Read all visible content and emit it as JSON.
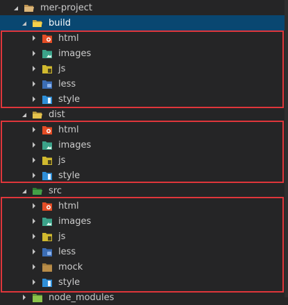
{
  "explorer": {
    "root": {
      "label": "mer-project",
      "icon": "folder-open-icon"
    },
    "build": {
      "label": "build",
      "icon": "folder-open-yellow-icon",
      "children": [
        {
          "label": "html",
          "icon": "html-folder-icon",
          "color": "#e44d26"
        },
        {
          "label": "images",
          "icon": "images-folder-icon",
          "color": "#3ba38a"
        },
        {
          "label": "js",
          "icon": "js-folder-icon",
          "color": "#d1ba2f"
        },
        {
          "label": "less",
          "icon": "less-folder-icon",
          "color": "#3b6db5"
        },
        {
          "label": "style",
          "icon": "style-folder-icon",
          "color": "#2f8fd8"
        }
      ]
    },
    "dist": {
      "label": "dist",
      "icon": "folder-open-yellow-icon",
      "children": [
        {
          "label": "html",
          "icon": "html-folder-icon",
          "color": "#e44d26"
        },
        {
          "label": "images",
          "icon": "images-folder-icon",
          "color": "#3ba38a"
        },
        {
          "label": "js",
          "icon": "js-folder-icon",
          "color": "#d1ba2f"
        },
        {
          "label": "style",
          "icon": "style-folder-icon",
          "color": "#2f8fd8"
        }
      ]
    },
    "src": {
      "label": "src",
      "icon": "folder-open-green-icon",
      "children": [
        {
          "label": "html",
          "icon": "html-folder-icon",
          "color": "#e44d26"
        },
        {
          "label": "images",
          "icon": "images-folder-icon",
          "color": "#3ba38a"
        },
        {
          "label": "js",
          "icon": "js-folder-icon",
          "color": "#d1ba2f"
        },
        {
          "label": "less",
          "icon": "less-folder-icon",
          "color": "#3b6db5"
        },
        {
          "label": "mock",
          "icon": "mock-folder-icon",
          "color": "#a07a3c"
        },
        {
          "label": "style",
          "icon": "style-folder-icon",
          "color": "#2f8fd8"
        }
      ]
    },
    "node_modules": {
      "label": "node_modules",
      "icon": "node-modules-folder-icon"
    }
  },
  "colors": {
    "background": "#252526",
    "selection": "#094771",
    "highlight_border": "#e0363b",
    "folder_yellow": "#dcb67a",
    "folder_green": "#3f9f3f"
  }
}
